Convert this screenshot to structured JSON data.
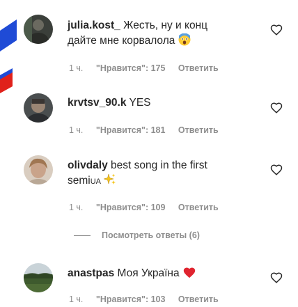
{
  "comments": [
    {
      "username": "julia.kost_",
      "text": "Жесть, ну и конц",
      "text_line2": "дайте мне корвалола",
      "emoji": "fearful-face",
      "time": "1 ч.",
      "likes": "\"Нравится\": 175",
      "reply": "Ответить"
    },
    {
      "username": "krvtsv_90.k",
      "text": "YES",
      "time": "1 ч.",
      "likes": "\"Нравится\": 181",
      "reply": "Ответить"
    },
    {
      "username": "olivdaly",
      "text": "best song in the first",
      "text_line2": "semi",
      "badge": "UA",
      "emoji": "sparkles",
      "time": "1 ч.",
      "likes": "\"Нравится\": 109",
      "reply": "Ответить"
    },
    {
      "username": "anastpas",
      "text": "Моя Україна",
      "emoji": "red-heart",
      "time": "1 ч.",
      "likes": "\"Нравится\": 103",
      "reply": "Ответить"
    }
  ],
  "view_replies": "Посмотреть ответы (6)",
  "colors": {
    "text": "#262626",
    "meta": "#8e8e8e",
    "flag_blue": "#1f4bd6",
    "flag_red": "#e0211b"
  }
}
